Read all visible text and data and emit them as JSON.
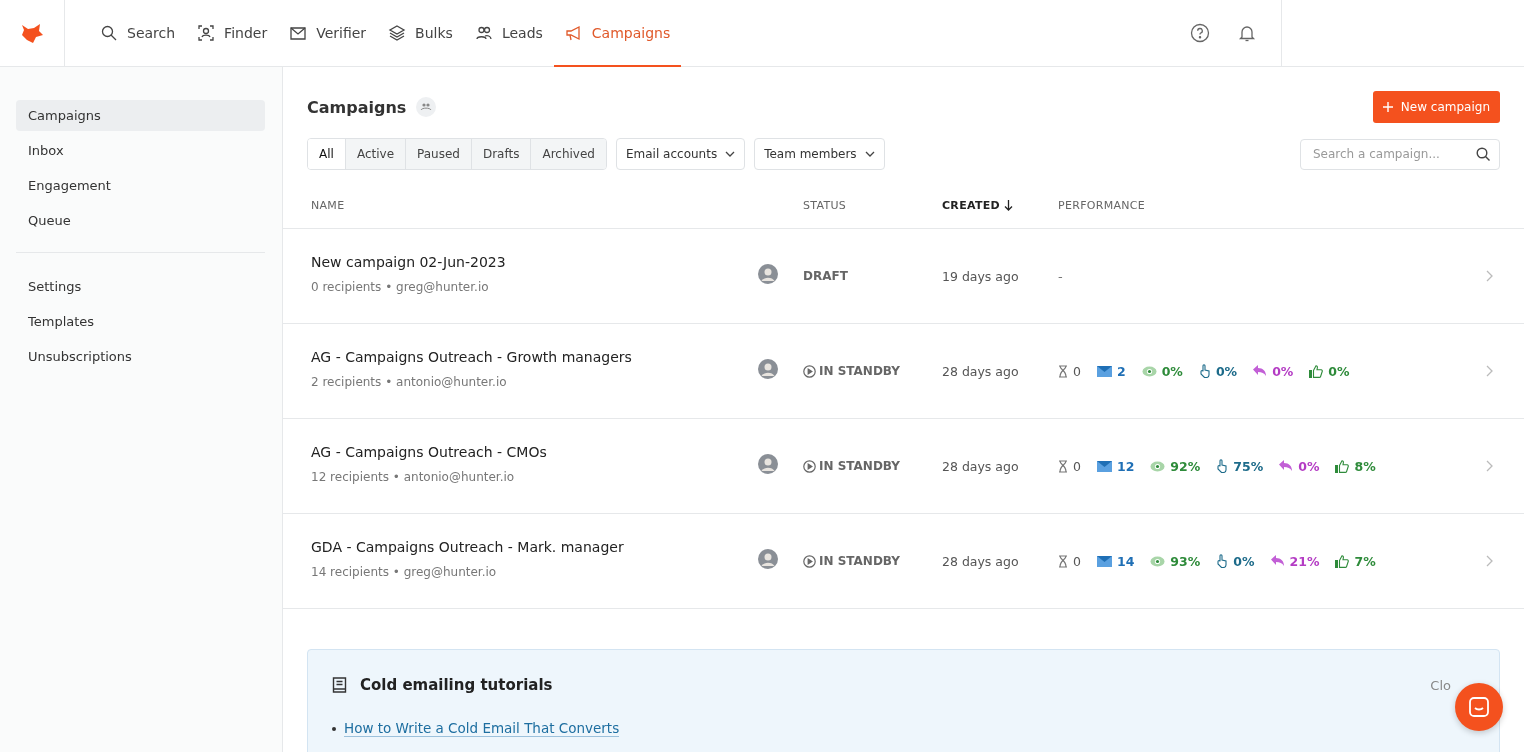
{
  "nav": [
    {
      "label": "Search",
      "selected": false
    },
    {
      "label": "Finder",
      "selected": false
    },
    {
      "label": "Verifier",
      "selected": false
    },
    {
      "label": "Bulks",
      "selected": false
    },
    {
      "label": "Leads",
      "selected": false
    },
    {
      "label": "Campaigns",
      "selected": true
    }
  ],
  "sidebar": {
    "groups": [
      [
        {
          "label": "Campaigns",
          "selected": true
        },
        {
          "label": "Inbox",
          "selected": false
        },
        {
          "label": "Engagement",
          "selected": false
        },
        {
          "label": "Queue",
          "selected": false
        }
      ],
      [
        {
          "label": "Settings",
          "selected": false
        },
        {
          "label": "Templates",
          "selected": false
        },
        {
          "label": "Unsubscriptions",
          "selected": false
        }
      ]
    ]
  },
  "page": {
    "title": "Campaigns",
    "new_button": "New campaign",
    "filters": [
      {
        "label": "All",
        "selected": true
      },
      {
        "label": "Active",
        "selected": false
      },
      {
        "label": "Paused",
        "selected": false
      },
      {
        "label": "Drafts",
        "selected": false
      },
      {
        "label": "Archived",
        "selected": false
      }
    ],
    "dropdowns": [
      "Email accounts",
      "Team members"
    ],
    "search": {
      "placeholder": "Search a campaign..."
    }
  },
  "table": {
    "columns": [
      "NAME",
      "STATUS",
      "CREATED",
      "PERFORMANCE"
    ],
    "rows": [
      {
        "name": "New campaign 02-Jun-2023",
        "meta": "0 recipients • greg@hunter.io",
        "status": "DRAFT",
        "kind": "draft",
        "created": "19 days ago",
        "performance": "-",
        "metrics": []
      },
      {
        "name": "AG - Campaigns Outreach - Growth managers",
        "meta": "2 recipients • antonio@hunter.io",
        "status": "IN STANDBY",
        "kind": "standby",
        "created": "28 days ago",
        "metrics": [
          {
            "kind": "pending",
            "value": "0"
          },
          {
            "kind": "sent",
            "value": "2"
          },
          {
            "kind": "opened",
            "value": "0%"
          },
          {
            "kind": "clicked",
            "value": "0%"
          },
          {
            "kind": "replied",
            "value": "0%"
          },
          {
            "kind": "interested",
            "value": "0%"
          }
        ]
      },
      {
        "name": "AG - Campaigns Outreach - CMOs",
        "meta": "12 recipients • antonio@hunter.io",
        "status": "IN STANDBY",
        "kind": "standby",
        "created": "28 days ago",
        "metrics": [
          {
            "kind": "pending",
            "value": "0"
          },
          {
            "kind": "sent",
            "value": "12"
          },
          {
            "kind": "opened",
            "value": "92%"
          },
          {
            "kind": "clicked",
            "value": "75%"
          },
          {
            "kind": "replied",
            "value": "0%"
          },
          {
            "kind": "interested",
            "value": "8%"
          }
        ]
      },
      {
        "name": "GDA - Campaigns Outreach - Mark. manager",
        "meta": "14 recipients • greg@hunter.io",
        "status": "IN STANDBY",
        "kind": "standby",
        "created": "28 days ago",
        "metrics": [
          {
            "kind": "pending",
            "value": "0"
          },
          {
            "kind": "sent",
            "value": "14"
          },
          {
            "kind": "opened",
            "value": "93%"
          },
          {
            "kind": "clicked",
            "value": "0%"
          },
          {
            "kind": "replied",
            "value": "21%"
          },
          {
            "kind": "interested",
            "value": "7%"
          }
        ]
      }
    ]
  },
  "tutorials": {
    "title": "Cold emailing tutorials",
    "close": "Clo",
    "links": [
      "How to Write a Cold Email That Converts"
    ]
  }
}
